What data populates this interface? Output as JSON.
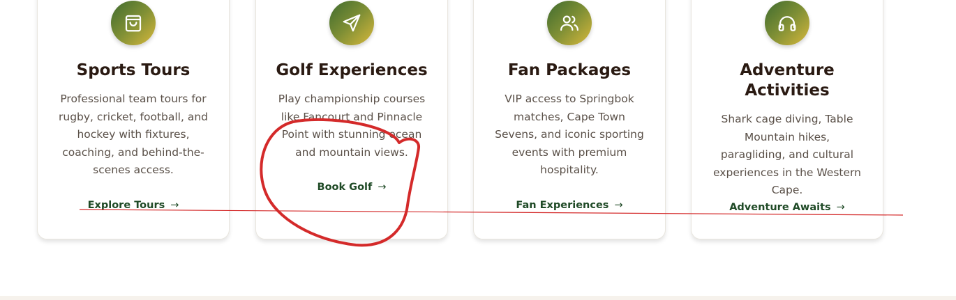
{
  "cards": [
    {
      "icon": "shopping-bag-icon",
      "title": "Sports Tours",
      "description": "Professional team tours for rugby, cricket, football, and hockey with fixtures, coaching, and behind-the-scenes access.",
      "link_label": "Explore Tours",
      "arrow": "→"
    },
    {
      "icon": "paper-plane-icon",
      "title": "Golf Experiences",
      "description": "Play championship courses like Fancourt and Pinnacle Point with stunning ocean and mountain views.",
      "link_label": "Book Golf",
      "arrow": "→"
    },
    {
      "icon": "users-icon",
      "title": "Fan Packages",
      "description": "VIP access to Springbok matches, Cape Town Sevens, and iconic sporting events with premium hospitality.",
      "link_label": "Fan Experiences",
      "arrow": "→"
    },
    {
      "icon": "headphones-icon",
      "title": "Adventure Activities",
      "description": "Shark cage diving, Table Mountain hikes, paragliding, and cultural experiences in the Western Cape.",
      "link_label": "Adventure Awaits",
      "arrow": "→"
    }
  ],
  "colors": {
    "icon_gradient_start": "#3f6b2f",
    "icon_gradient_end": "#d8b83c",
    "title": "#2a1a12",
    "link": "#1f4a26",
    "annotation": "#d42a2a"
  }
}
